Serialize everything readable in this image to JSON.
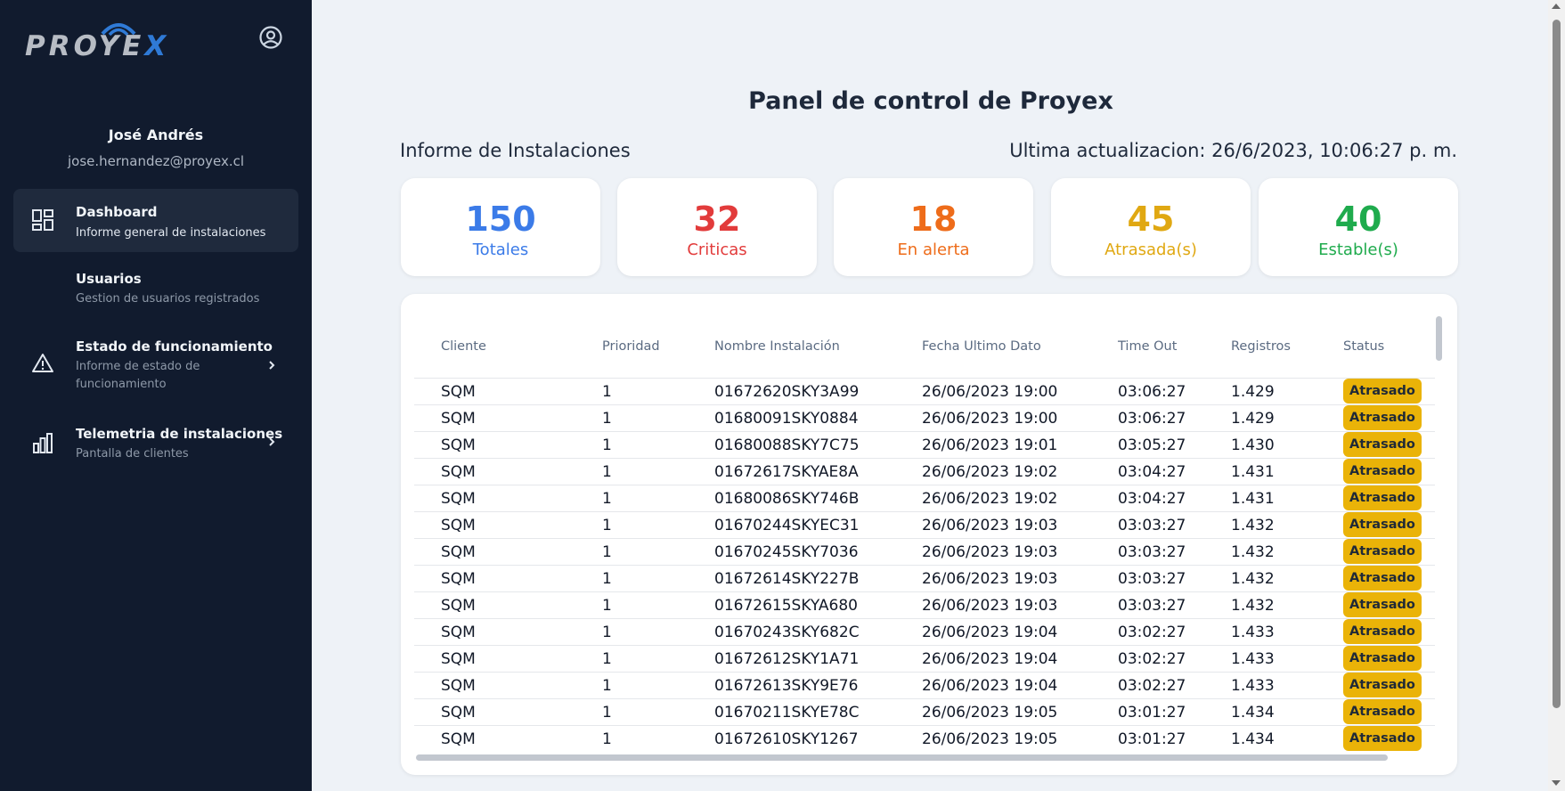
{
  "brand": {
    "logo_part1": "PRO",
    "logo_part2": "YE",
    "logo_part3": "X",
    "accent": "#2f7ad6"
  },
  "user": {
    "name": "José Andrés",
    "email": "jose.hernandez@proyex.cl"
  },
  "nav": [
    {
      "title": "Dashboard",
      "subtitle": "Informe general de instalaciones",
      "icon": "dashboard-icon",
      "active": true
    },
    {
      "title": "Usuarios",
      "subtitle": "Gestion de usuarios registrados",
      "icon": "",
      "active": false
    },
    {
      "title": "Estado de funcionamiento",
      "subtitle": "Informe de estado de funcionamiento",
      "icon": "warning-icon",
      "active": false
    },
    {
      "title": "Telemetria de instalaciones",
      "subtitle": "Pantalla de clientes",
      "icon": "bar-chart-icon",
      "active": false
    }
  ],
  "main": {
    "page_title": "Panel de control de Proyex",
    "section_title": "Informe de Instalaciones",
    "last_update": "Ultima actualizacion: 26/6/2023, 10:06:27 p. m."
  },
  "stats": [
    {
      "value": "150",
      "label": "Totales",
      "color": "#3b7be8"
    },
    {
      "value": "32",
      "label": "Criticas",
      "color": "#e23b3b"
    },
    {
      "value": "18",
      "label": "En alerta",
      "color": "#ee6c1a"
    },
    {
      "value": "45",
      "label": "Atrasada(s)",
      "color": "#e0a812"
    },
    {
      "value": "40",
      "label": "Estable(s)",
      "color": "#1fab4d"
    }
  ],
  "table": {
    "headers": [
      "Cliente",
      "Prioridad",
      "Nombre Instalación",
      "Fecha Ultimo Dato",
      "Time Out",
      "Registros",
      "Status"
    ],
    "rows": [
      [
        "SQM",
        "1",
        "01672620SKY3A99",
        "26/06/2023 19:00",
        "03:06:27",
        "1.429",
        "Atrasado"
      ],
      [
        "SQM",
        "1",
        "01680091SKY0884",
        "26/06/2023 19:00",
        "03:06:27",
        "1.429",
        "Atrasado"
      ],
      [
        "SQM",
        "1",
        "01680088SKY7C75",
        "26/06/2023 19:01",
        "03:05:27",
        "1.430",
        "Atrasado"
      ],
      [
        "SQM",
        "1",
        "01672617SKYAE8A",
        "26/06/2023 19:02",
        "03:04:27",
        "1.431",
        "Atrasado"
      ],
      [
        "SQM",
        "1",
        "01680086SKY746B",
        "26/06/2023 19:02",
        "03:04:27",
        "1.431",
        "Atrasado"
      ],
      [
        "SQM",
        "1",
        "01670244SKYEC31",
        "26/06/2023 19:03",
        "03:03:27",
        "1.432",
        "Atrasado"
      ],
      [
        "SQM",
        "1",
        "01670245SKY7036",
        "26/06/2023 19:03",
        "03:03:27",
        "1.432",
        "Atrasado"
      ],
      [
        "SQM",
        "1",
        "01672614SKY227B",
        "26/06/2023 19:03",
        "03:03:27",
        "1.432",
        "Atrasado"
      ],
      [
        "SQM",
        "1",
        "01672615SKYA680",
        "26/06/2023 19:03",
        "03:03:27",
        "1.432",
        "Atrasado"
      ],
      [
        "SQM",
        "1",
        "01670243SKY682C",
        "26/06/2023 19:04",
        "03:02:27",
        "1.433",
        "Atrasado"
      ],
      [
        "SQM",
        "1",
        "01672612SKY1A71",
        "26/06/2023 19:04",
        "03:02:27",
        "1.433",
        "Atrasado"
      ],
      [
        "SQM",
        "1",
        "01672613SKY9E76",
        "26/06/2023 19:04",
        "03:02:27",
        "1.433",
        "Atrasado"
      ],
      [
        "SQM",
        "1",
        "01670211SKYE78C",
        "26/06/2023 19:05",
        "03:01:27",
        "1.434",
        "Atrasado"
      ],
      [
        "SQM",
        "1",
        "01672610SKY1267",
        "26/06/2023 19:05",
        "03:01:27",
        "1.434",
        "Atrasado"
      ]
    ],
    "status_color": "#eab308"
  }
}
